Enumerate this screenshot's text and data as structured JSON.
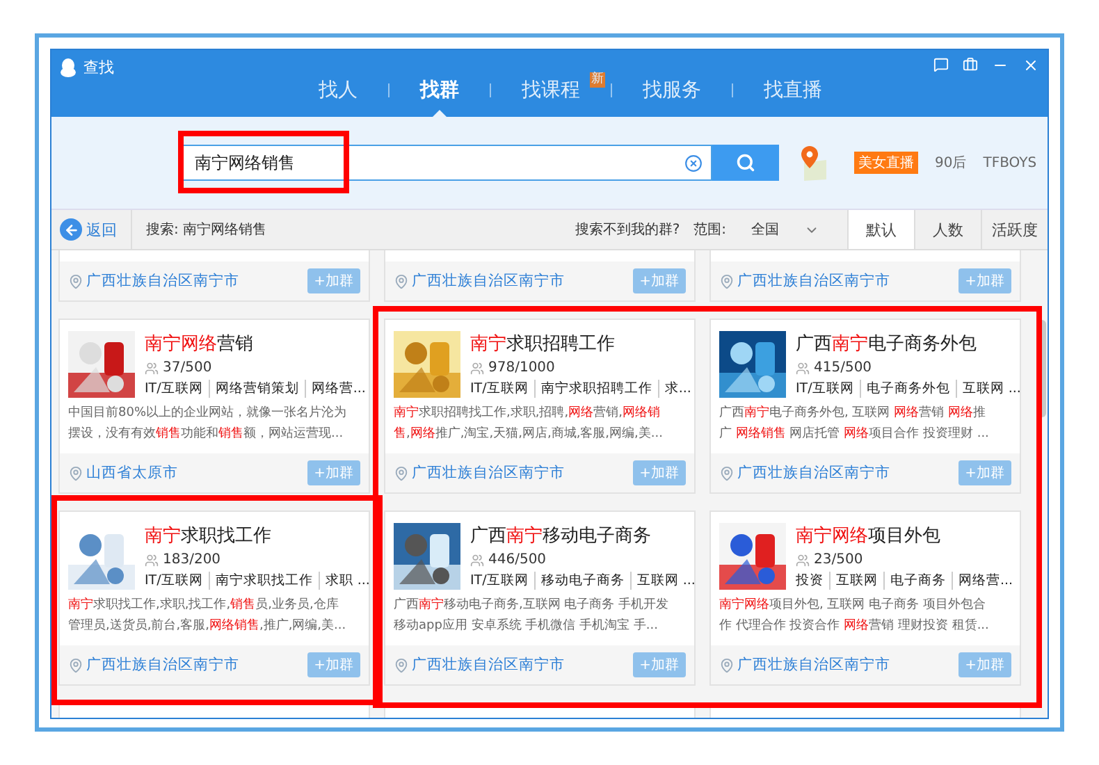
{
  "window": {
    "title": "查找"
  },
  "tabs": [
    {
      "label": "找人",
      "selected": false
    },
    {
      "label": "找群",
      "selected": true
    },
    {
      "label": "找课程",
      "selected": false,
      "badge": "新"
    },
    {
      "label": "找服务",
      "selected": false
    },
    {
      "label": "找直播",
      "selected": false
    }
  ],
  "search": {
    "value": "南宁网络销售",
    "hot_tag": "美女直播",
    "links": [
      "90后",
      "TFBOYS"
    ]
  },
  "filter_bar": {
    "back": "返回",
    "query": "搜索: 南宁网络销售",
    "not_found": "搜索不到我的群?",
    "scope_label": "范围:",
    "scope": "全国",
    "sort": [
      {
        "label": "默认",
        "selected": true
      },
      {
        "label": "人数",
        "selected": false
      },
      {
        "label": "活跃度",
        "selected": false
      }
    ]
  },
  "partial_cards": [
    {
      "location": "广西壮族自治区南宁市",
      "join": "+加群"
    },
    {
      "location": "广西壮族自治区南宁市",
      "join": "+加群"
    },
    {
      "location": "广西壮族自治区南宁市",
      "join": "+加群"
    }
  ],
  "cards": [
    {
      "title": "**南宁网络**营销",
      "members": "37/500",
      "tags": [
        "IT/互联网",
        "网络营销策划",
        "网络营..."
      ],
      "description": "中国目前80%以上的企业网站，就像一张名片沦为摆设，没有有效**销售**功能和**销售**额，网站运营现...",
      "location": "山西省太原市",
      "join": "+加群",
      "image": {
        "kind": "picture"
      }
    },
    {
      "title": "**南宁**求职招聘工作",
      "members": "978/1000",
      "tags": [
        "IT/互联网",
        "南宁求职招聘工作",
        "求..."
      ],
      "description": "**南宁**求职招聘找工作,求职,招聘,**网络**营销,**网络销售**,**网络**推广,淘宝,天猫,网店,商城,客服,网编,美...",
      "location": "广西壮族自治区南宁市",
      "join": "+加群",
      "image": {
        "kind": "picture"
      }
    },
    {
      "title": "广西**南宁**电子商务外包",
      "members": "415/500",
      "tags": [
        "IT/互联网",
        "电子商务外包",
        "互联网 ..."
      ],
      "description": "广西**南宁**电子商务外包, 互联网  **网络**营销 **网络**推广 **网络销售** 网店托管 **网络**项目合作 投资理财 ...",
      "location": "广西壮族自治区南宁市",
      "join": "+加群",
      "image": {
        "kind": "picture"
      }
    },
    {
      "title": "**南宁**求职找工作",
      "members": "183/200",
      "tags": [
        "IT/互联网",
        "南宁求职找工作",
        "求职 ..."
      ],
      "description": "**南宁**求职找工作,求职,找工作,**销售**员,业务员,仓库管理员,送货员,前台,客服,**网络销售**,推广,网编,美...",
      "location": "广西壮族自治区南宁市",
      "join": "+加群",
      "image": {
        "kind": "picture"
      }
    },
    {
      "title": "广西**南宁**移动电子商务",
      "members": "446/500",
      "tags": [
        "IT/互联网",
        "移动电子商务",
        "互联网 ..."
      ],
      "description": "广西**南宁**移动电子商务,互联网 电子商务 手机开发移动app应用 安卓系统 手机微信 手机淘宝 手...",
      "location": "广西壮族自治区南宁市",
      "join": "+加群",
      "image": {
        "kind": "picture"
      }
    },
    {
      "title": "**南宁网络**项目外包",
      "members": "23/500",
      "tags": [
        "投资",
        "互联网",
        "电子商务",
        "网络营..."
      ],
      "description": "**南宁网络**项目外包, 互联网  电子商务 项目外包合作 代理合作 投资合作 **网络**营销 理财投资 租赁...",
      "location": "广西壮族自治区南宁市",
      "join": "+加群",
      "image": {
        "kind": "picture"
      }
    }
  ]
}
